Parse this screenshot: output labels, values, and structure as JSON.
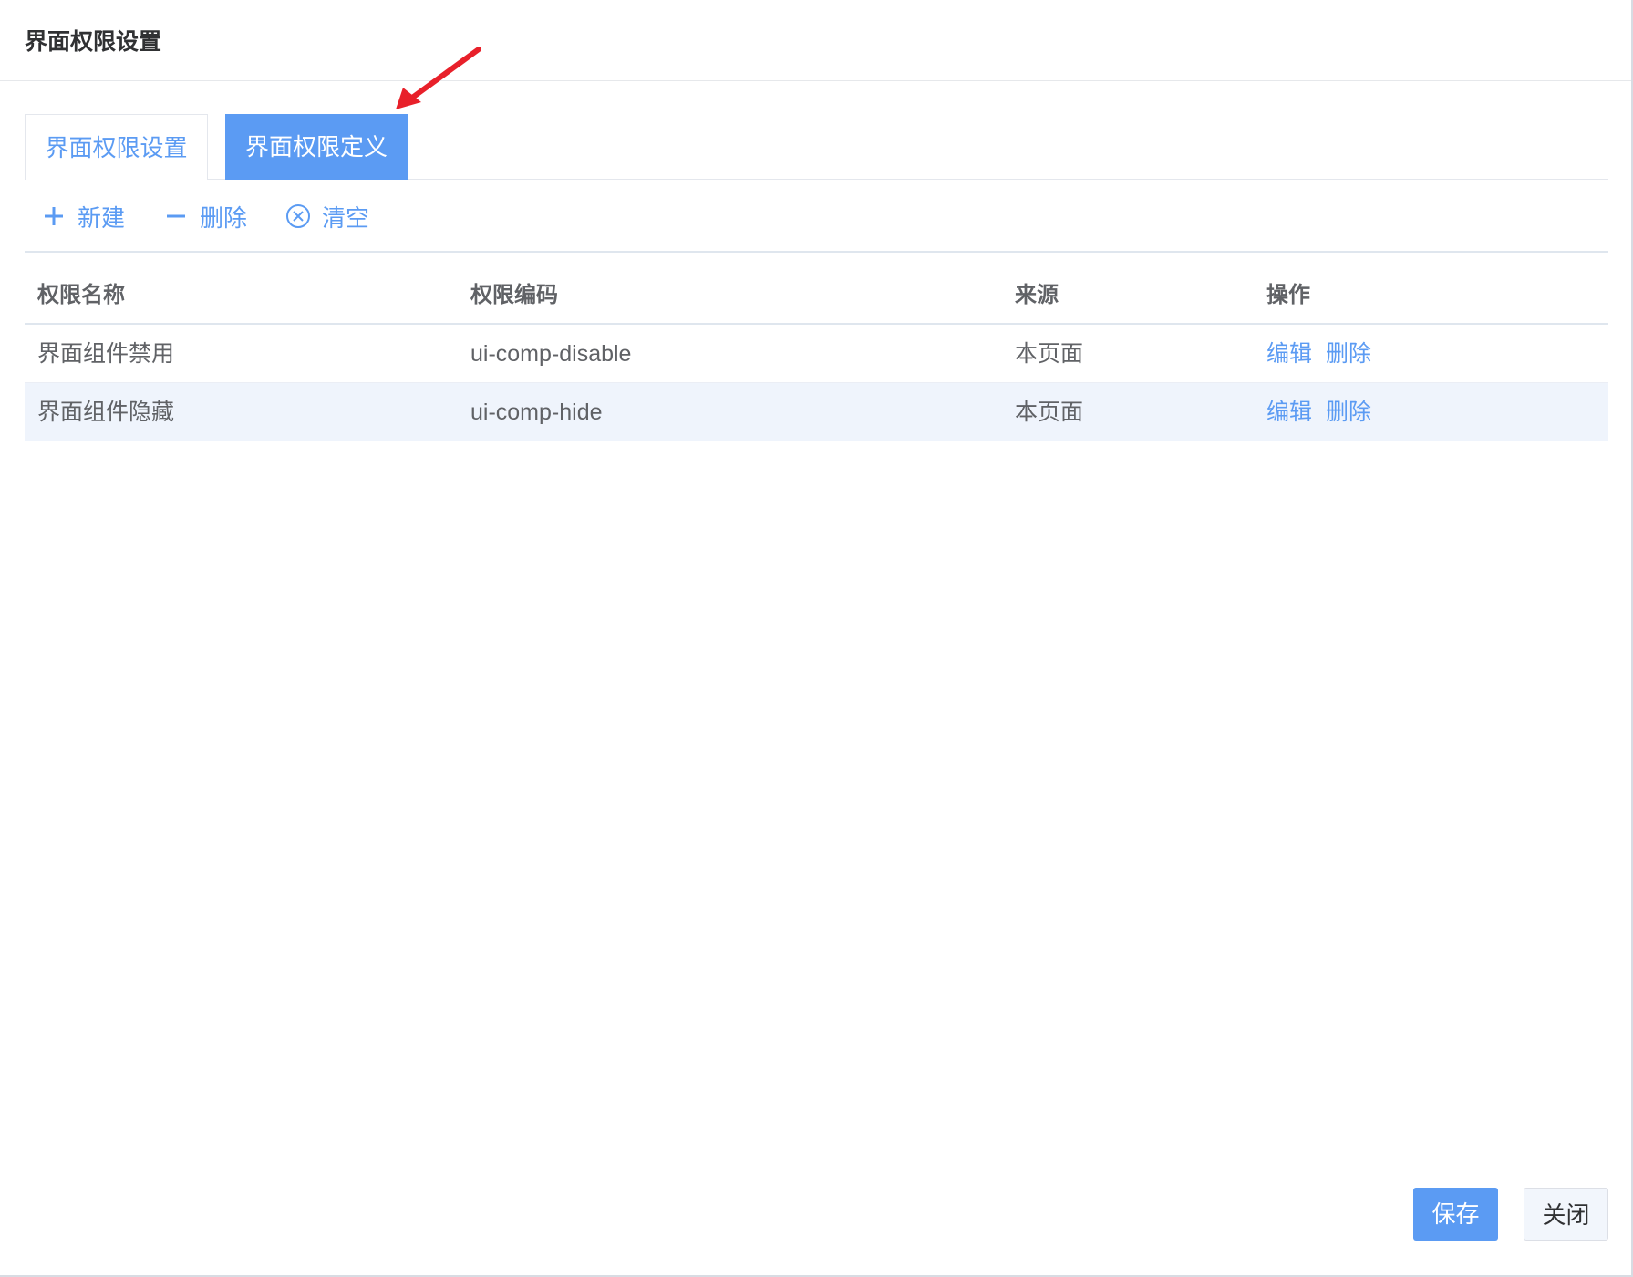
{
  "dialog": {
    "title": "界面权限设置"
  },
  "tabs": [
    {
      "label": "界面权限设置",
      "active": false
    },
    {
      "label": "界面权限定义",
      "active": true
    }
  ],
  "toolbar": {
    "new_label": "新建",
    "delete_label": "删除",
    "clear_label": "清空"
  },
  "table": {
    "headers": [
      "权限名称",
      "权限编码",
      "来源",
      "操作"
    ],
    "rows": [
      {
        "name": "界面组件禁用",
        "code": "ui-comp-disable",
        "source": "本页面",
        "edit": "编辑",
        "delete": "删除"
      },
      {
        "name": "界面组件隐藏",
        "code": "ui-comp-hide",
        "source": "本页面",
        "edit": "编辑",
        "delete": "删除"
      }
    ]
  },
  "footer": {
    "save_label": "保存",
    "close_label": "关闭"
  },
  "colors": {
    "accent": "#5b9bf3",
    "annotation_arrow": "#e8202a",
    "row_alt": "#eff4fc"
  }
}
